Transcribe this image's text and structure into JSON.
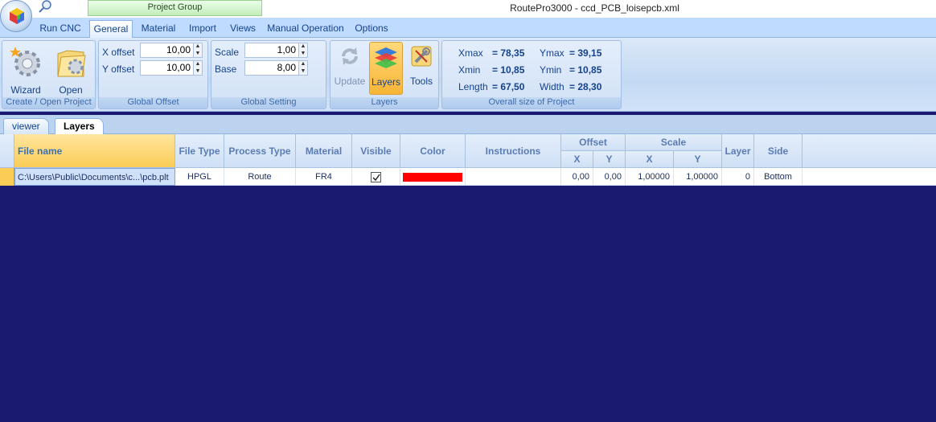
{
  "window": {
    "title": "RoutePro3000 - ccd_PCB_loisepcb.xml",
    "context_tab": "Project Group"
  },
  "tabs": [
    "Run CNC",
    "General",
    "Material",
    "Import",
    "Views",
    "Manual Operation",
    "Options"
  ],
  "active_tab": "General",
  "ribbon": {
    "create_open": {
      "label": "Create / Open Project",
      "wizard": "Wizard",
      "open": "Open"
    },
    "global_offset": {
      "label": "Global Offset",
      "x_label": "X offset",
      "x_value": "10,00",
      "y_label": "Y offset",
      "y_value": "10,00"
    },
    "global_setting": {
      "label": "Global Setting",
      "scale_label": "Scale",
      "scale_value": "1,00",
      "base_label": "Base",
      "base_value": "8,00"
    },
    "layers_group": {
      "label": "Layers",
      "update": "Update",
      "layers": "Layers",
      "tools": "Tools"
    },
    "overall_size": {
      "label": "Overall size of Project",
      "xmax_label": "Xmax",
      "xmax": "= 78,35",
      "ymax_label": "Ymax",
      "ymax": "= 39,15",
      "xmin_label": "Xmin",
      "xmin": "= 10,85",
      "ymin_label": "Ymin",
      "ymin": "= 10,85",
      "length_label": "Length",
      "length": "= 67,50",
      "width_label": "Width",
      "width": "= 28,30"
    }
  },
  "doc_tabs": [
    "viewer",
    "Layers"
  ],
  "grid": {
    "headers": {
      "file_name": "File name",
      "file_type": "File Type",
      "process_type": "Process Type",
      "material": "Material",
      "visible": "Visible",
      "color": "Color",
      "instructions": "Instructions",
      "offset": "Offset",
      "scale": "Scale",
      "x": "X",
      "y": "Y",
      "layer": "Layer",
      "side": "Side"
    },
    "row": {
      "file_name": "C:\\Users\\Public\\Documents\\c...\\pcb.plt",
      "file_type": "HPGL",
      "process_type": "Route",
      "material": "FR4",
      "visible": true,
      "color": "#ff0000",
      "instructions": "",
      "offset_x": "0,00",
      "offset_y": "0,00",
      "scale_x": "1,00000",
      "scale_y": "1,00000",
      "layer": "0",
      "side": "Bottom"
    }
  },
  "colors": {
    "workspace": "#1a1a70",
    "ribbon": "#c3d9f3",
    "accent": "#fbcd57"
  }
}
